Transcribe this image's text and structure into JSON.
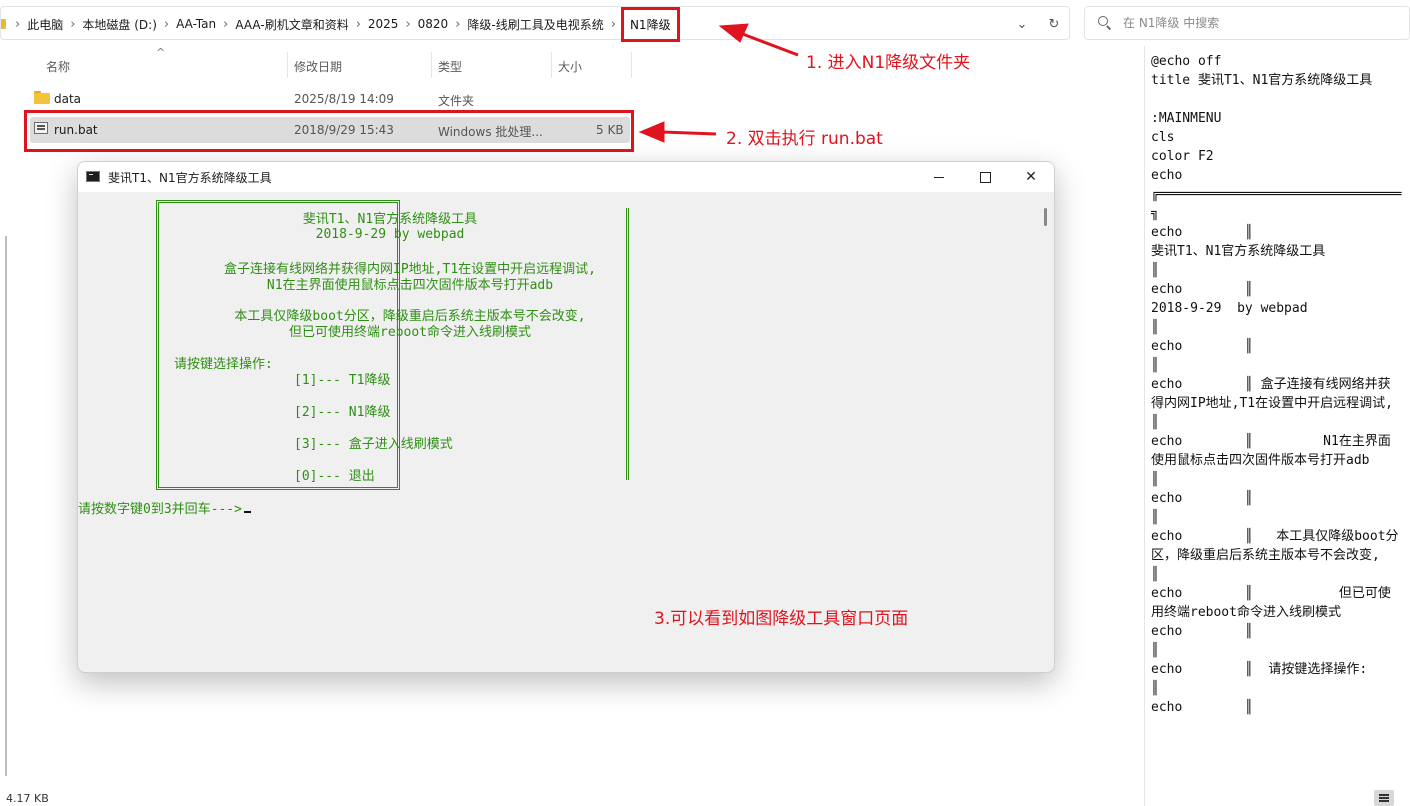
{
  "address_bar": {
    "crumbs": [
      "此电脑",
      "本地磁盘 (D:)",
      "AA-Tan",
      "AAA-刷机文章和资料",
      "2025",
      "0820",
      "降级-线刷工具及电视系统"
    ],
    "current": "N1降级"
  },
  "search": {
    "placeholder": "在 N1降级 中搜索"
  },
  "columns": {
    "name": "名称",
    "modified": "修改日期",
    "type": "类型",
    "size": "大小"
  },
  "files": [
    {
      "name": "data",
      "modified": "2025/8/19 14:09",
      "type": "文件夹",
      "size": "",
      "icon": "folder-icon"
    },
    {
      "name": "run.bat",
      "modified": "2018/9/29 15:43",
      "type": "Windows 批处理...",
      "size": "5 KB",
      "icon": "batch-file-icon"
    }
  ],
  "annotations": {
    "step1": "1. 进入N1降级文件夹",
    "step2": "2. 双击执行 run.bat",
    "step3": "3.可以看到如图降级工具窗口页面",
    "color": "#e0141e"
  },
  "console": {
    "title": "斐讯T1、N1官方系统降级工具",
    "text_color": "#2f8f15",
    "heading": "斐讯T1、N1官方系统降级工具",
    "date_line": "2018-9-29  by webpad",
    "info1a": "盒子连接有线网络并获得内网IP地址,T1在设置中开启远程调试,",
    "info1b": "N1在主界面使用鼠标点击四次固件版本号打开adb",
    "info2a": "本工具仅降级boot分区，降级重启后系统主版本号不会改变,",
    "info2b": "但已可使用终端reboot命令进入线刷模式",
    "prompt_heading": "请按键选择操作:",
    "options": [
      "[1]--- T1降级",
      "[2]--- N1降级",
      "[3]--- 盒子进入线刷模式",
      "[0]--- 退出"
    ],
    "input_prompt": "请按数字键0到3并回车--->"
  },
  "preview_text": "@echo off\ntitle 斐讯T1、N1官方系统降级工具\n\n:MAINMENU\ncls\ncolor F2\necho\n╔═══════════════════════════════\n╗\necho        ║\n斐讯T1、N1官方系统降级工具\n║\necho        ║\n2018-9-29  by webpad\n║\necho        ║\n║\necho        ║ 盒子连接有线网络并获得内网IP地址,T1在设置中开启远程调试, ║\necho        ║         N1在主界面使用鼠标点击四次固件版本号打开adb      ║\necho        ║\n║\necho        ║   本工具仅降级boot分区，降级重启后系统主版本号不会改变,  ║\necho        ║           但已可使用终端reboot命令进入线刷模式\necho        ║\n║\necho        ║  请按键选择操作:\n║\necho        ║",
  "status_bar": {
    "size": "4.17 KB"
  }
}
